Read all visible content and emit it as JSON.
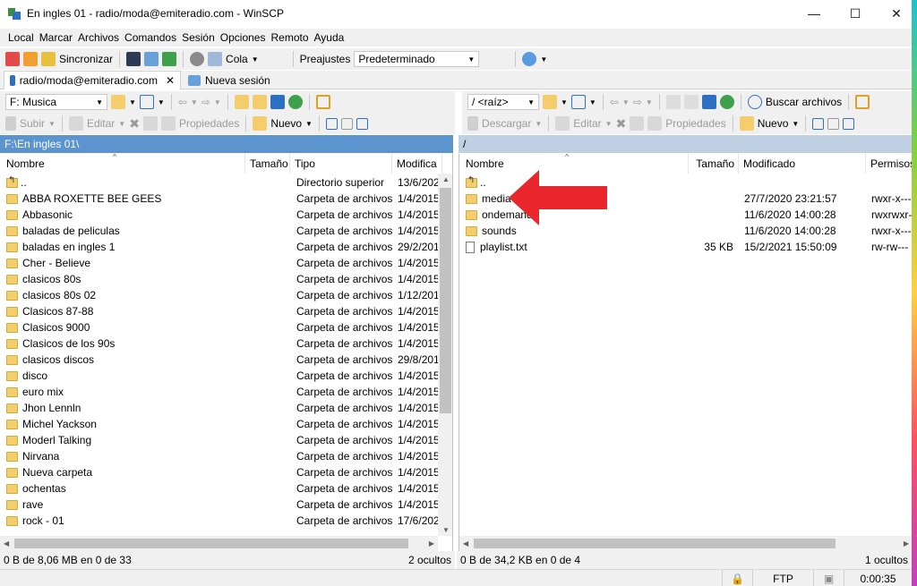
{
  "window": {
    "title": "En ingles 01 - radio/moda@emiteradio.com - WinSCP",
    "minimize": "—",
    "maximize": "☐",
    "close": "✕"
  },
  "menu": [
    "Local",
    "Marcar",
    "Archivos",
    "Comandos",
    "Sesión",
    "Opciones",
    "Remoto",
    "Ayuda"
  ],
  "toolbar": {
    "sync_label": "Sincronizar",
    "queue_label": "Cola",
    "presets_label": "Preajustes",
    "presets_value": "Predeterminado"
  },
  "tabs": {
    "session": "radio/moda@emiteradio.com",
    "close": "✕",
    "new_session": "Nueva sesión"
  },
  "left": {
    "drive": "F: Musica",
    "actions": {
      "upload": "Subir",
      "edit": "Editar",
      "properties": "Propiedades",
      "new": "Nuevo"
    },
    "path": "F:\\En ingles 01\\",
    "columns": [
      "Nombre",
      "Tamaño",
      "Tipo",
      "Modifica"
    ],
    "files": [
      {
        "name": "..",
        "size": "",
        "type": "Directorio superior",
        "modified": "13/6/202"
      },
      {
        "name": "ABBA ROXETTE BEE GEES",
        "size": "",
        "type": "Carpeta de archivos",
        "modified": "1/4/2015"
      },
      {
        "name": "Abbasonic",
        "size": "",
        "type": "Carpeta de archivos",
        "modified": "1/4/2015"
      },
      {
        "name": "baladas de peliculas",
        "size": "",
        "type": "Carpeta de archivos",
        "modified": "1/4/2015"
      },
      {
        "name": "baladas en ingles 1",
        "size": "",
        "type": "Carpeta de archivos",
        "modified": "29/2/201"
      },
      {
        "name": "Cher - Believe",
        "size": "",
        "type": "Carpeta de archivos",
        "modified": "1/4/2015"
      },
      {
        "name": "clasicos 80s",
        "size": "",
        "type": "Carpeta de archivos",
        "modified": "1/4/2015"
      },
      {
        "name": "clasicos 80s 02",
        "size": "",
        "type": "Carpeta de archivos",
        "modified": "1/12/201"
      },
      {
        "name": "Clasicos 87-88",
        "size": "",
        "type": "Carpeta de archivos",
        "modified": "1/4/2015"
      },
      {
        "name": "Clasicos 9000",
        "size": "",
        "type": "Carpeta de archivos",
        "modified": "1/4/2015"
      },
      {
        "name": "Clasicos de los 90s",
        "size": "",
        "type": "Carpeta de archivos",
        "modified": "1/4/2015"
      },
      {
        "name": "clasicos discos",
        "size": "",
        "type": "Carpeta de archivos",
        "modified": "29/8/201"
      },
      {
        "name": "disco",
        "size": "",
        "type": "Carpeta de archivos",
        "modified": "1/4/2015"
      },
      {
        "name": "euro mix",
        "size": "",
        "type": "Carpeta de archivos",
        "modified": "1/4/2015"
      },
      {
        "name": "Jhon Lennln",
        "size": "",
        "type": "Carpeta de archivos",
        "modified": "1/4/2015"
      },
      {
        "name": "Michel Yackson",
        "size": "",
        "type": "Carpeta de archivos",
        "modified": "1/4/2015"
      },
      {
        "name": "Moderl Talking",
        "size": "",
        "type": "Carpeta de archivos",
        "modified": "1/4/2015"
      },
      {
        "name": "Nirvana",
        "size": "",
        "type": "Carpeta de archivos",
        "modified": "1/4/2015"
      },
      {
        "name": "Nueva carpeta",
        "size": "",
        "type": "Carpeta de archivos",
        "modified": "1/4/2015"
      },
      {
        "name": "ochentas",
        "size": "",
        "type": "Carpeta de archivos",
        "modified": "1/4/2015"
      },
      {
        "name": "rave",
        "size": "",
        "type": "Carpeta de archivos",
        "modified": "1/4/2015"
      },
      {
        "name": "rock - 01",
        "size": "",
        "type": "Carpeta de archivos",
        "modified": "17/6/202"
      }
    ],
    "status": "0 B de 8,06 MB en 0 de 33",
    "hidden": "2 ocultos"
  },
  "right": {
    "drive": "/ <raíz>",
    "actions": {
      "download": "Descargar",
      "edit": "Editar",
      "properties": "Propiedades",
      "new": "Nuevo",
      "find": "Buscar archivos"
    },
    "path": "/",
    "columns": [
      "Nombre",
      "Tamaño",
      "Modificado",
      "Permisos"
    ],
    "files": [
      {
        "name": "..",
        "size": "",
        "modified": "",
        "perms": "",
        "kind": "up"
      },
      {
        "name": "media",
        "size": "",
        "modified": "27/7/2020 23:21:57",
        "perms": "rwxr-x---",
        "kind": "folder"
      },
      {
        "name": "ondemand",
        "size": "",
        "modified": "11/6/2020 14:00:28",
        "perms": "rwxrwxr-",
        "kind": "folder"
      },
      {
        "name": "sounds",
        "size": "",
        "modified": "11/6/2020 14:00:28",
        "perms": "rwxr-x---",
        "kind": "folder"
      },
      {
        "name": "playlist.txt",
        "size": "35 KB",
        "modified": "15/2/2021 15:50:09",
        "perms": "rw-rw---",
        "kind": "file"
      }
    ],
    "status": "0 B de 34,2 KB en 0 de 4",
    "hidden": "1 ocultos"
  },
  "statusbar": {
    "protocol": "FTP",
    "time": "0:00:35"
  },
  "colors": {
    "accent_path": "#5b94cf",
    "arrow": "#e8262b",
    "folder": "#f4ce6c"
  }
}
